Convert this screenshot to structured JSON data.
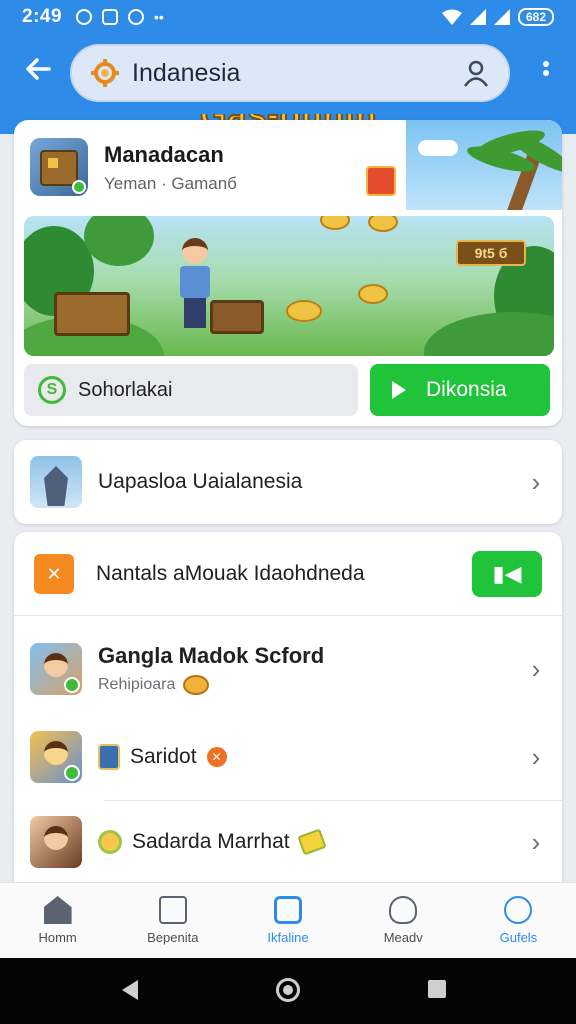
{
  "status_bar": {
    "time": "2:49",
    "battery": "682"
  },
  "app_bar": {
    "search_text": "Indanesia"
  },
  "banner": {
    "title": "Gas-ohnin"
  },
  "featured": {
    "title": "Manadacan",
    "subtitle": "Yeman · Gamanб",
    "score_badge": "9t5 б",
    "share_label": "Sohorlakai",
    "download_label": "Dikonsia"
  },
  "row_card": {
    "label": "Uapasloa Uaialanesia"
  },
  "list": {
    "top_label": "Nantals aМouak Idaohdneda",
    "toggle_label": "▮◀",
    "items": [
      {
        "title": "Gangla Madok Scford",
        "subtitle": "Rehipioara"
      },
      {
        "title": "Saridot"
      },
      {
        "title": "Sadarda Marrhat"
      }
    ]
  },
  "bottom_nav": {
    "items": [
      {
        "label": "Homm"
      },
      {
        "label": "Bepenita"
      },
      {
        "label": "Ikfaline"
      },
      {
        "label": "Meadv"
      },
      {
        "label": "Gufels"
      }
    ],
    "active_index": 2
  },
  "colors": {
    "primary": "#2f8be8",
    "accent_green": "#1fc43a",
    "accent_orange": "#f48a1f"
  },
  "icons": [
    "gear-icon",
    "person-icon",
    "chevron-right-icon",
    "play-icon",
    "share-icon",
    "home-icon",
    "back-icon"
  ]
}
